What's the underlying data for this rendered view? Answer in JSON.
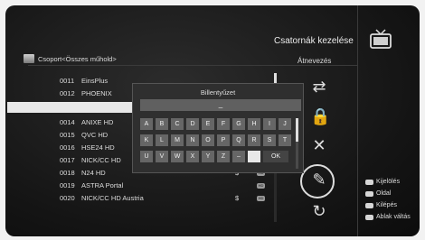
{
  "header": {
    "title": "Csatornák kezelése",
    "rename": "Átnevezés"
  },
  "group": {
    "label": "Csoport<Összes műhold>"
  },
  "channels": [
    {
      "num": "0011",
      "name": "EinsPlus",
      "dollar": "",
      "hd": ""
    },
    {
      "num": "0012",
      "name": "PHOENIX",
      "dollar": "",
      "hd": ""
    },
    {
      "num": "",
      "name": "",
      "dollar": "",
      "hd": ""
    },
    {
      "num": "0014",
      "name": "ANIXE HD",
      "dollar": "",
      "hd": ""
    },
    {
      "num": "0015",
      "name": "QVC HD",
      "dollar": "",
      "hd": ""
    },
    {
      "num": "0016",
      "name": "HSE24 HD",
      "dollar": "",
      "hd": ""
    },
    {
      "num": "0017",
      "name": "NICK/CC HD",
      "dollar": "",
      "hd": ""
    },
    {
      "num": "0018",
      "name": "N24 HD",
      "dollar": "$",
      "hd": "HD"
    },
    {
      "num": "0019",
      "name": "ASTRA Portal",
      "dollar": "",
      "hd": "HD"
    },
    {
      "num": "0020",
      "name": "NICK/CC HD Austria",
      "dollar": "$",
      "hd": "HD"
    }
  ],
  "keyboard": {
    "title": "Billentyűzet",
    "input": "_",
    "rows": [
      [
        "A",
        "B",
        "C",
        "D",
        "E",
        "F",
        "G",
        "H",
        "I",
        "J"
      ],
      [
        "K",
        "L",
        "M",
        "N",
        "O",
        "P",
        "Q",
        "R",
        "S",
        "T"
      ],
      [
        "U",
        "V",
        "W",
        "X",
        "Y",
        "Z",
        "–",
        "",
        "OK"
      ]
    ]
  },
  "legend": [
    {
      "label": "Kijelölés"
    },
    {
      "label": "Oldal"
    },
    {
      "label": "Kilépés"
    },
    {
      "label": "Ablak váltás"
    }
  ]
}
